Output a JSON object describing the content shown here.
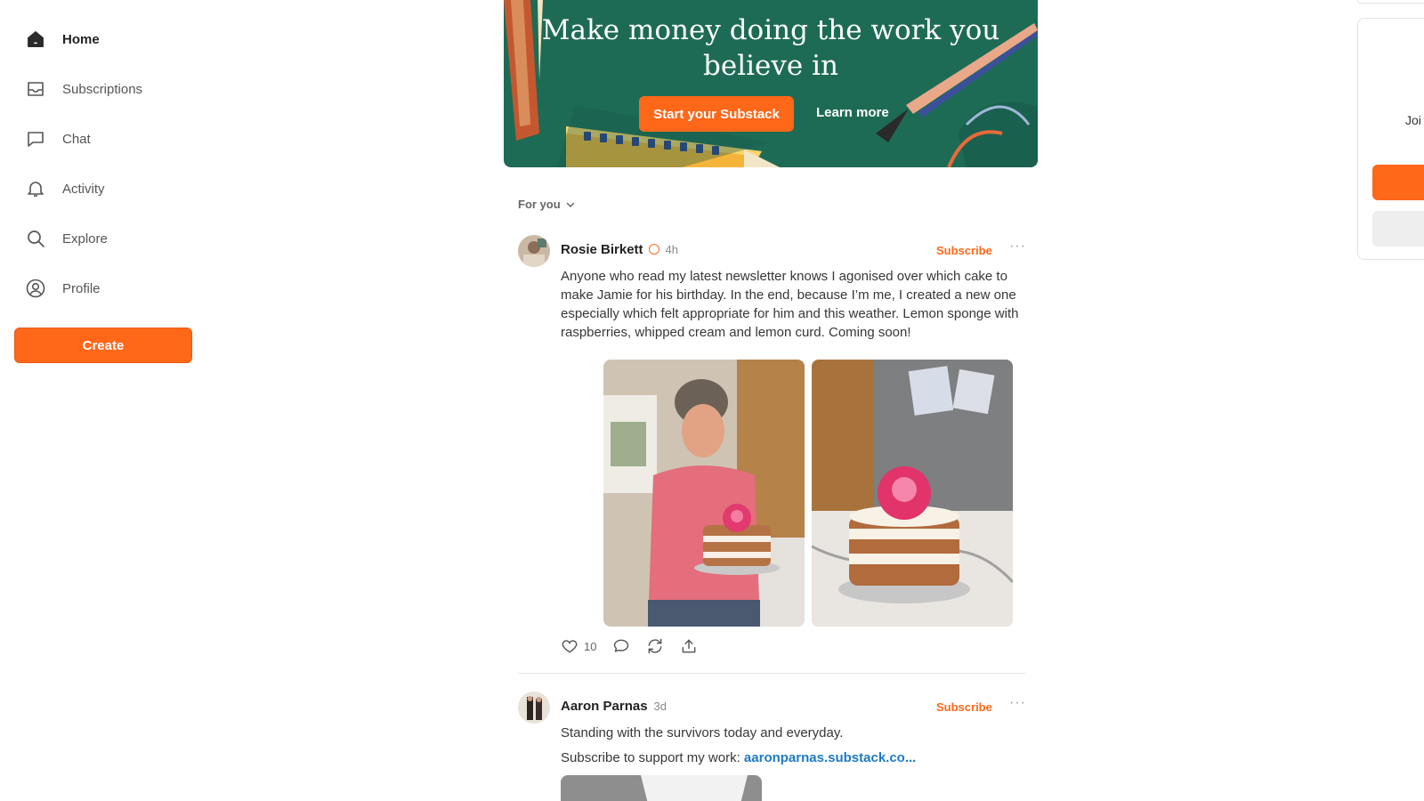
{
  "sidebar": {
    "items": [
      {
        "label": "Home",
        "icon": "home-icon",
        "active": true
      },
      {
        "label": "Subscriptions",
        "icon": "inbox-icon"
      },
      {
        "label": "Chat",
        "icon": "chat-icon"
      },
      {
        "label": "Activity",
        "icon": "bell-icon"
      },
      {
        "label": "Explore",
        "icon": "search-icon"
      },
      {
        "label": "Profile",
        "icon": "profile-icon"
      }
    ],
    "create_label": "Create"
  },
  "banner": {
    "title": "Make money doing the work you believe in",
    "start_label": "Start your Substack",
    "learn_label": "Learn more"
  },
  "feed": {
    "filter_label": "For you",
    "posts": [
      {
        "author": "Rosie Birkett",
        "verified": true,
        "time": "4h",
        "subscribe_label": "Subscribe",
        "more_label": "···",
        "text": "Anyone who read my latest newsletter knows I agonised over which cake to make Jamie for his birthday. In the end, because I’m me, I created a new one especially which felt appropriate for him and this weather. Lemon sponge with raspberries, whipped cream and lemon curd. Coming soon!",
        "likes": "10"
      },
      {
        "author": "Aaron Parnas",
        "time": "3d",
        "subscribe_label": "Subscribe",
        "more_label": "···",
        "text": "Standing with the survivors today and everyday.",
        "support_text": "Subscribe to support my work: ",
        "link_text": "aaronparnas.substack.co..."
      }
    ]
  },
  "right_panel": {
    "join_text": "Joi"
  },
  "colors": {
    "accent": "#FF6719",
    "banner_bg": "#1e6b55",
    "link": "#1d7ac4"
  }
}
